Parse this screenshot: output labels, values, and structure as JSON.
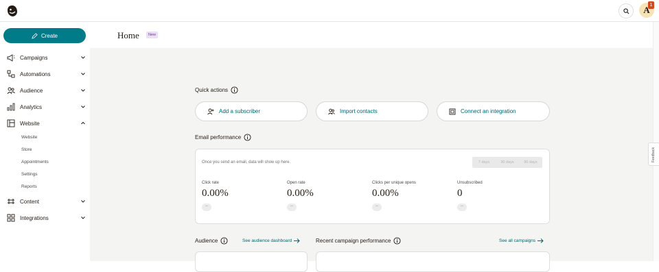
{
  "header": {
    "avatar_initial": "A",
    "notification_count": "1"
  },
  "sidebar": {
    "create_label": "Create",
    "items": [
      {
        "label": "Campaigns",
        "icon": "megaphone-icon"
      },
      {
        "label": "Automations",
        "icon": "automation-icon"
      },
      {
        "label": "Audience",
        "icon": "audience-icon"
      },
      {
        "label": "Analytics",
        "icon": "bar-chart-icon"
      },
      {
        "label": "Website",
        "icon": "website-icon"
      },
      {
        "label": "Content",
        "icon": "content-icon"
      },
      {
        "label": "Integrations",
        "icon": "grid-icon"
      }
    ],
    "website_subitems": [
      "Website",
      "Store",
      "Appointments",
      "Settings",
      "Reports"
    ]
  },
  "page": {
    "title": "Home",
    "badge": "New"
  },
  "quick_actions": {
    "title": "Quick actions",
    "buttons": [
      "Add a subscriber",
      "Import contacts",
      "Connect an integration"
    ]
  },
  "email_performance": {
    "title": "Email performance",
    "empty_message": "Once you send an email, data will show up here.",
    "ranges": [
      "7 days",
      "30 days",
      "90 days"
    ],
    "metrics": [
      {
        "label": "Click rate",
        "value": "0.00%",
        "delta": "--"
      },
      {
        "label": "Open rate",
        "value": "0.00%",
        "delta": "--"
      },
      {
        "label": "Clicks per unique opens",
        "value": "0.00%",
        "delta": "--"
      },
      {
        "label": "Unsubscribed",
        "value": "0",
        "delta": "--"
      }
    ]
  },
  "audience": {
    "title": "Audience",
    "link": "See audience dashboard"
  },
  "recent": {
    "title": "Recent campaign performance",
    "link": "See all campaigns"
  },
  "feedback_label": "Feedback",
  "colors": {
    "brand": "#007c89",
    "link": "#006570",
    "badge_bg": "#ecdff5"
  }
}
